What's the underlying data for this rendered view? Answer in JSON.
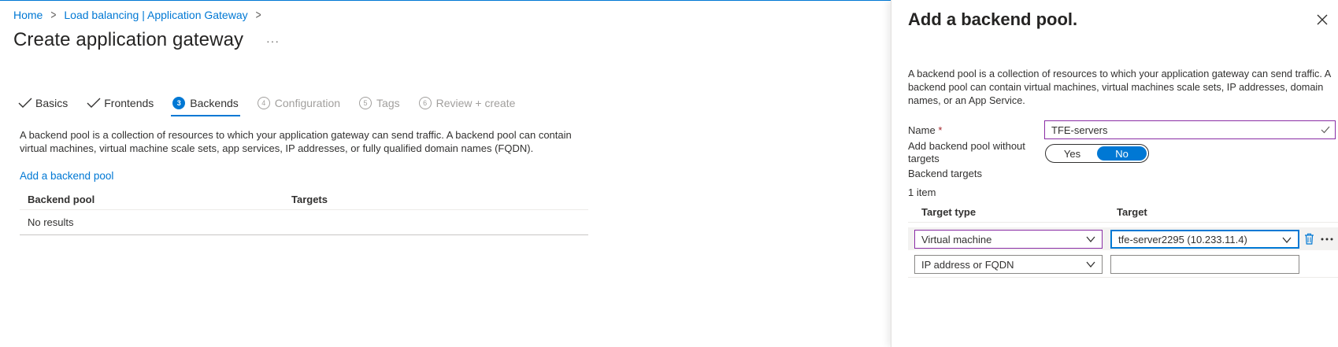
{
  "breadcrumb": {
    "home": "Home",
    "parent": "Load balancing | Application Gateway",
    "sep": ">"
  },
  "page": {
    "title": "Create application gateway",
    "more": "···"
  },
  "tabs": [
    {
      "label": "Basics",
      "state": "done"
    },
    {
      "label": "Frontends",
      "state": "done"
    },
    {
      "num": "3",
      "label": "Backends",
      "state": "active"
    },
    {
      "num": "4",
      "label": "Configuration",
      "state": "disabled"
    },
    {
      "num": "5",
      "label": "Tags",
      "state": "disabled"
    },
    {
      "num": "6",
      "label": "Review + create",
      "state": "disabled"
    }
  ],
  "main": {
    "description": "A backend pool is a collection of resources to which your application gateway can send traffic. A backend pool can contain virtual machines, virtual machine scale sets, app services, IP addresses, or fully qualified domain names (FQDN).",
    "add_link": "Add a backend pool",
    "table": {
      "headers": [
        "Backend pool",
        "Targets"
      ],
      "empty": "No results"
    }
  },
  "panel": {
    "title": "Add a backend pool.",
    "description": "A backend pool is a collection of resources to which your application gateway can send traffic. A backend pool can contain virtual machines, virtual machines scale sets, IP addresses, domain names, or an App Service.",
    "name_label": "Name",
    "required_mark": "*",
    "name_value": "TFE-servers",
    "without_targets_label": "Add backend pool without targets",
    "toggle": {
      "yes": "Yes",
      "no": "No",
      "selected": "No"
    },
    "backend_targets_label": "Backend targets",
    "item_count": "1 item",
    "columns": {
      "type": "Target type",
      "target": "Target"
    },
    "rows": [
      {
        "type": "Virtual machine",
        "target": "tfe-server2295 (10.233.11.4)"
      },
      {
        "type": "IP address or FQDN",
        "target": ""
      }
    ]
  },
  "colors": {
    "accent": "#0078d4",
    "focus": "#8a2da5",
    "required": "#a4262c"
  }
}
